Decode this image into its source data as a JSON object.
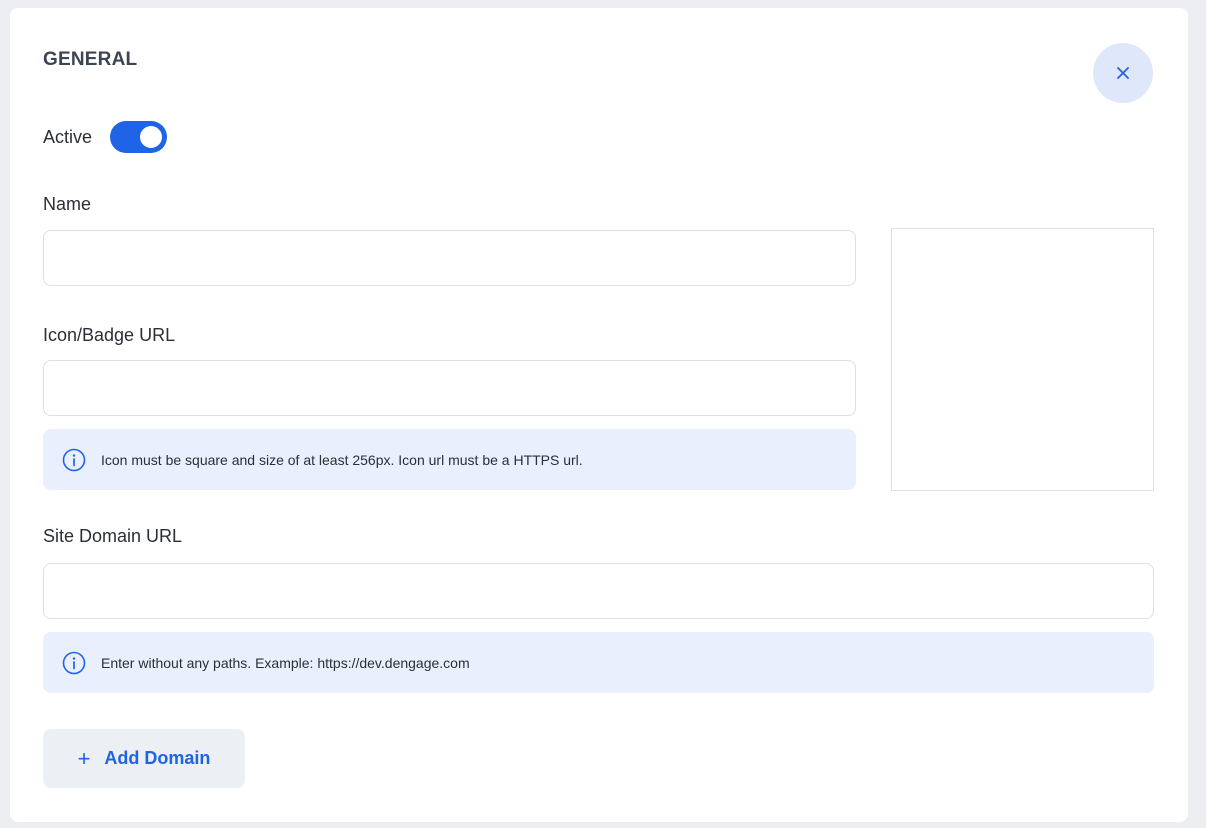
{
  "section": {
    "title": "GENERAL"
  },
  "active": {
    "label": "Active",
    "enabled": true
  },
  "fields": {
    "name": {
      "label": "Name",
      "value": "",
      "placeholder": ""
    },
    "icon_url": {
      "label": "Icon/Badge URL",
      "value": "",
      "placeholder": "",
      "hint": "Icon must be square and size of at least 256px. Icon url must be a HTTPS url."
    },
    "site_domain": {
      "label": "Site Domain URL",
      "value": "",
      "placeholder": "",
      "hint": "Enter without any paths. Example: https://dev.dengage.com"
    }
  },
  "actions": {
    "add_domain_plus": "+",
    "add_domain_label": "Add Domain",
    "close_glyph": "×"
  },
  "icons": {
    "close": "close-icon",
    "info": "info-icon",
    "plus": "plus-icon"
  },
  "colors": {
    "accent": "#1f63e6",
    "info_bg": "#e9effc",
    "close_bg": "#dfe7fb"
  }
}
